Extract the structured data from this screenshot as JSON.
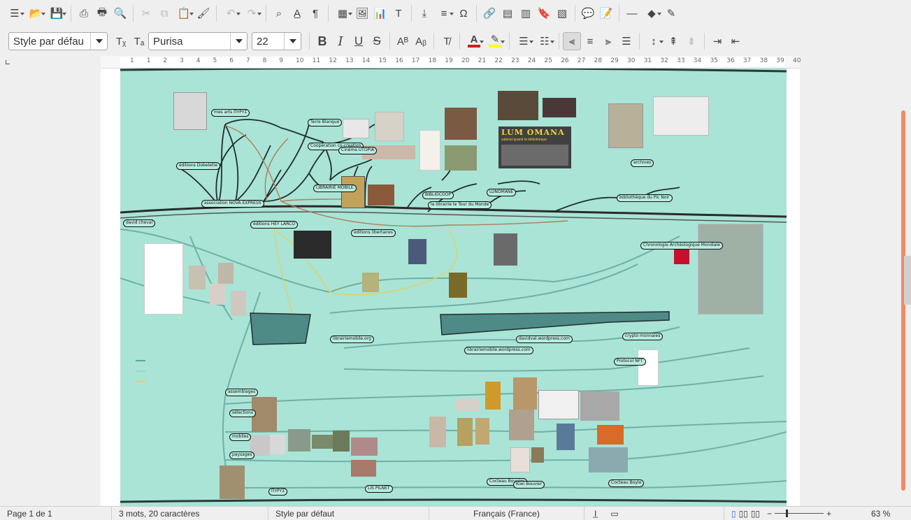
{
  "toolbar1": {
    "icons": [
      "sidebar-icon",
      "open-icon",
      "save-icon",
      "export-pdf-icon",
      "print-icon",
      "print-preview-icon",
      "cut-icon",
      "copy-icon",
      "paste-icon",
      "clone-icon",
      "undo-icon",
      "redo-icon",
      "find-icon",
      "spelling-icon",
      "formatting-marks-icon",
      "table-icon",
      "image-icon",
      "chart-icon",
      "textbox-icon",
      "page-break-icon",
      "field-icon",
      "special-char-icon",
      "hyperlink-icon",
      "footnote-icon",
      "endnote-icon",
      "bookmark-icon",
      "cross-reference-icon",
      "comment-icon",
      "track-changes-icon",
      "line-icon",
      "shapes-icon",
      "draw-icon"
    ]
  },
  "toolbar2": {
    "paragraph_style": "Style par défau",
    "font_name": "Purisa",
    "font_size": "22",
    "bold": "B",
    "italic": "I",
    "underline": "U",
    "strike": "S",
    "font_color": "#c9211e",
    "highlight_color": "#ffff00"
  },
  "ruler": {
    "ticks": [
      "1",
      "1",
      "2",
      "3",
      "4",
      "5",
      "6",
      "7",
      "8",
      "9",
      "10",
      "11",
      "12",
      "13",
      "14",
      "15",
      "16",
      "17",
      "18",
      "19",
      "20",
      "21",
      "22",
      "23",
      "24",
      "25",
      "26",
      "27",
      "28",
      "29",
      "30",
      "31",
      "32",
      "33",
      "34",
      "35",
      "36",
      "37",
      "38",
      "39",
      "40"
    ]
  },
  "document": {
    "banner_title": "LUM OMANA",
    "banner_subtitle": "cabinet quand la bibliothèque",
    "notes": [
      {
        "text": "mes arts ΠΥΡΥΣ"
      },
      {
        "text": "Terre Blanque"
      },
      {
        "text": "Coopération co-creation"
      },
      {
        "text": "Cinéma UTOPIA"
      },
      {
        "text": "éditions Dobelette"
      },
      {
        "text": "association NOVA EXPRESS"
      },
      {
        "text": "LIBRAIRIE MOBILE"
      },
      {
        "text": "BIBLIOCOOP"
      },
      {
        "text": "la librairie le Tour du Monde"
      },
      {
        "text": "LUNOMANE"
      },
      {
        "text": "bibliothèque du Pic Noir"
      },
      {
        "text": "david cheval"
      },
      {
        "text": "éditions HEY LARCO"
      },
      {
        "text": "éditions libertaires"
      },
      {
        "text": "Chronologie Archéologique Mondiale"
      },
      {
        "text": "librairiemobile.org"
      },
      {
        "text": "davidval.wordpress.com"
      },
      {
        "text": "librairiemobile.wordpress.com"
      },
      {
        "text": "crypto monnaies"
      },
      {
        "text": "Protocol NFT"
      },
      {
        "text": "assemblages"
      },
      {
        "text": "sélections"
      },
      {
        "text": "mobiles"
      },
      {
        "text": "paysages"
      },
      {
        "text": "ΠΥΡΥΣ"
      },
      {
        "text": "LIS PILNET"
      },
      {
        "text": "Cocteau Bouvier"
      },
      {
        "text": "Kiwi Bouvier"
      },
      {
        "text": "Cocteau Boyle"
      },
      {
        "text": "archives"
      }
    ]
  },
  "status": {
    "page": "Page 1 de 1",
    "words": "3 mots, 20 caractères",
    "style": "Style par défaut",
    "language": "Français (France)",
    "zoom": "63 %"
  }
}
